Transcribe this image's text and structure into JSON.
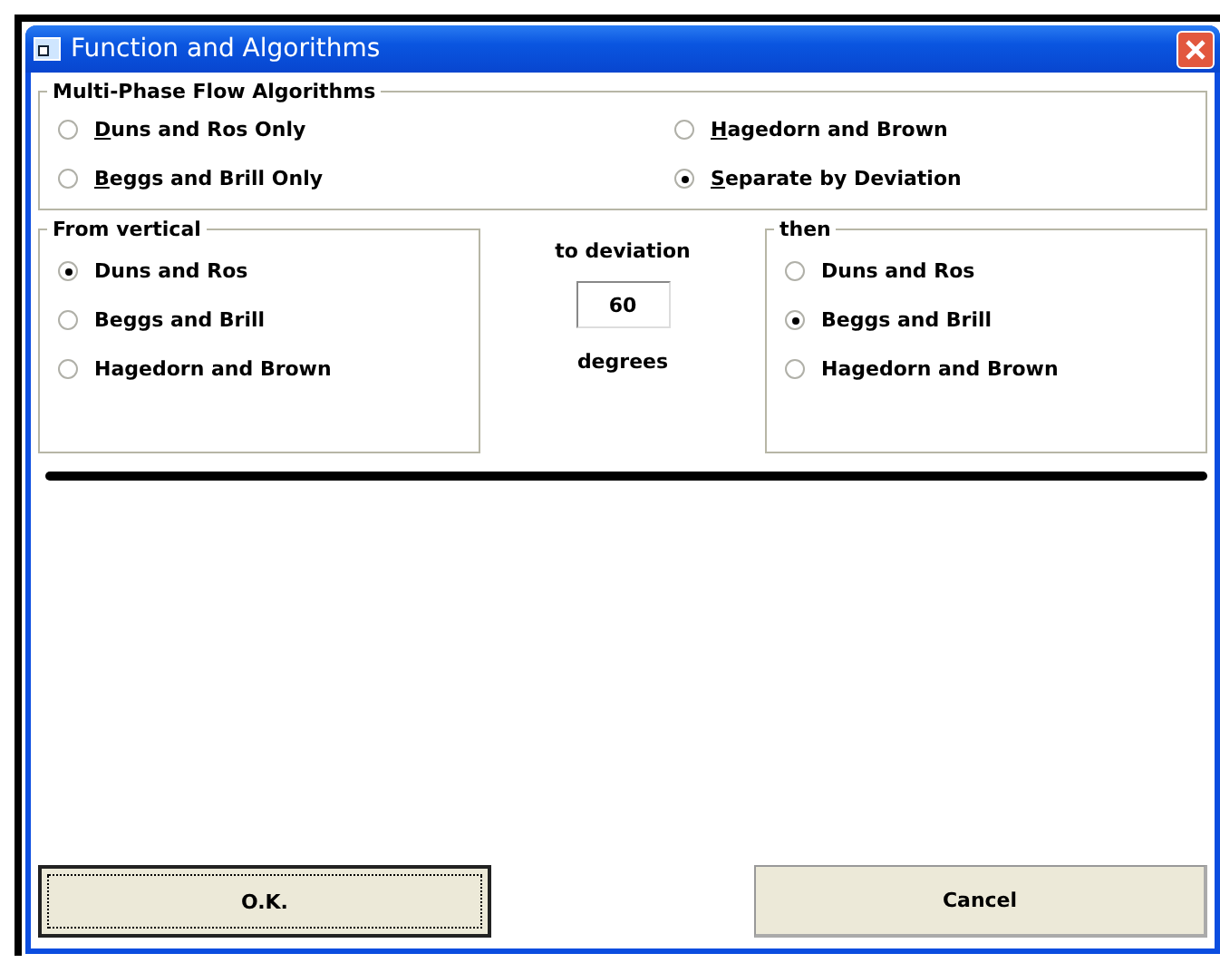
{
  "window": {
    "title": "Function and Algorithms"
  },
  "multiphase": {
    "title": "Multi-Phase Flow Algorithms",
    "options": [
      {
        "label": "Duns and Ros Only",
        "access_key_underlined": true,
        "selected": false
      },
      {
        "label": "Hagedorn and Brown",
        "access_key_underlined": true,
        "selected": false
      },
      {
        "label": "Beggs and Brill Only",
        "access_key_underlined": true,
        "selected": false
      },
      {
        "label": "Separate by Deviation",
        "access_key_underlined": true,
        "selected": true
      }
    ]
  },
  "from_vertical": {
    "title": "From vertical",
    "options": [
      {
        "label": "Duns and Ros",
        "selected": true
      },
      {
        "label": "Beggs and Brill",
        "selected": false
      },
      {
        "label": "Hagedorn and Brown",
        "selected": false
      }
    ]
  },
  "deviation": {
    "label": "to deviation",
    "value": "60",
    "unit": "degrees"
  },
  "then": {
    "title": "then",
    "options": [
      {
        "label": "Duns and Ros",
        "selected": false
      },
      {
        "label": "Beggs and Brill",
        "selected": true
      },
      {
        "label": "Hagedorn and Brown",
        "selected": false
      }
    ]
  },
  "buttons": [
    {
      "label": "O.K.",
      "default": true
    },
    {
      "label": "Cancel",
      "default": false
    }
  ]
}
